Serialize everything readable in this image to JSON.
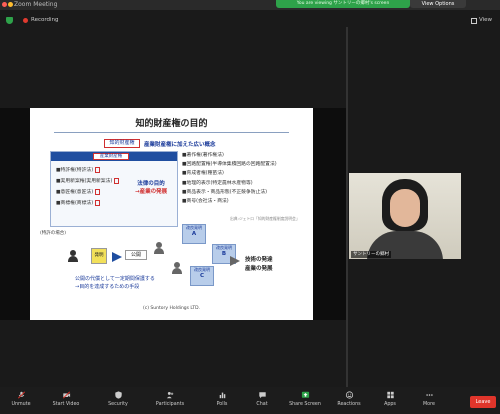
{
  "window": {
    "title": "Zoom Meeting"
  },
  "banner": {
    "sharing_text": "You are viewing サントリーの郷村's screen",
    "view_options": "View Options"
  },
  "topbar": {
    "recording": "Recording",
    "view": "View"
  },
  "slide": {
    "title": "知的財産権の目的",
    "keyword": "知的財産権",
    "keyword_suffix": "産業財産権に加えた広い概念",
    "panel_head": "産業財産権",
    "panel_items": [
      "特許権(特許法)",
      "実用新案権(実用新案法)",
      "意匠権(意匠法)",
      "商標権(商標法)"
    ],
    "law_purpose_line1": "法律の目的",
    "law_purpose_line2": "→産業の発展",
    "right_items": [
      "著作権(著作権法)",
      "回路配置権(半導体集積回路の回路配置法)",
      "育成者権(種苗法)",
      "地理的表示(特定農林水産物等)",
      "商品表示・商品形態(不正競争防止法)",
      "商号(会社法・商法)"
    ],
    "right_note": "出典:ジェトロ「知的財産権制度説明会」",
    "flow_label": "(特許の場合)",
    "invent": "発明",
    "publish": "公開",
    "patent_a_title": "改良発明",
    "patent_a_letter": "A",
    "patent_b_title": "改良発明",
    "patent_b_letter": "B",
    "patent_c_title": "改良発明",
    "patent_c_letter": "C",
    "outcome_line1": "技術の発達",
    "outcome_line2": "産業の発展",
    "blue_note_line1": "公開の代償として一定期間保護する",
    "blue_note_line2": "→目的を達成するための手段",
    "copyright": "(c) Suntory Holdings LTD."
  },
  "participant": {
    "name": "サントリーの郷村"
  },
  "toolbar": {
    "items": [
      {
        "label": "Unmute",
        "icon": "microphone-muted-icon"
      },
      {
        "label": "Start Video",
        "icon": "video-off-icon"
      },
      {
        "label": "Security",
        "icon": "shield-icon"
      },
      {
        "label": "Participants",
        "icon": "participants-icon"
      },
      {
        "label": "Chat",
        "icon": "chat-icon"
      },
      {
        "label": "Polls",
        "icon": "polls-icon"
      },
      {
        "label": "Share Screen",
        "icon": "share-screen-icon"
      },
      {
        "label": "Reactions",
        "icon": "reactions-icon"
      },
      {
        "label": "Apps",
        "icon": "apps-icon"
      },
      {
        "label": "More",
        "icon": "more-icon"
      }
    ],
    "end": "Leave"
  },
  "colors": {
    "share_green": "#2ea24a",
    "end_red": "#e0352b",
    "slide_blue": "#1f4ea0"
  }
}
